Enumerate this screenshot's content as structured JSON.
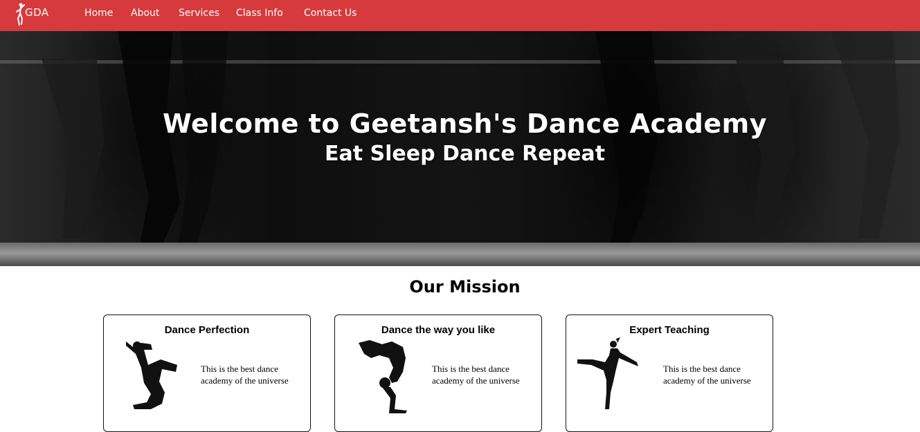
{
  "nav": {
    "logo_text": "GDA",
    "items": [
      {
        "label": "Home"
      },
      {
        "label": "About"
      },
      {
        "label": "Services"
      },
      {
        "label": "Class Info"
      },
      {
        "label": "Contact Us"
      }
    ]
  },
  "hero": {
    "title": "Welcome to Geetansh's Dance Academy",
    "subtitle": "Eat Sleep Dance Repeat"
  },
  "mission": {
    "title": "Our Mission",
    "cards": [
      {
        "title": "Dance Perfection",
        "text": "This is the best dance academy of the universe",
        "image": "jumping-dancer-silhouette"
      },
      {
        "title": "Dance the way you like",
        "text": "This is the best dance academy of the universe",
        "image": "breakdancer-silhouette"
      },
      {
        "title": "Expert Teaching",
        "text": "This is the best dance academy of the universe",
        "image": "ballet-dancer-silhouette"
      }
    ]
  },
  "colors": {
    "navbar": "#d63a3c",
    "hero_bg": "#111111",
    "text": "#000000"
  }
}
